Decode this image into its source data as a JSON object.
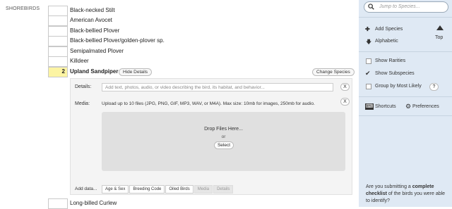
{
  "checklist": {
    "section_label": "SHOREBIRDS",
    "species": [
      {
        "name": "Black-necked Stilt",
        "count": ""
      },
      {
        "name": "American Avocet",
        "count": ""
      },
      {
        "name": "Black-bellied Plover",
        "count": ""
      },
      {
        "name": "Black-bellied Plover/golden-plover sp.",
        "count": ""
      },
      {
        "name": "Semipalmated Plover",
        "count": ""
      },
      {
        "name": "Killdeer",
        "count": ""
      },
      {
        "name": "Upland Sandpiper",
        "count": "2"
      },
      {
        "name": "Long-billed Curlew",
        "count": ""
      }
    ],
    "hide_details_label": "Hide Details",
    "change_species_label": "Change Species"
  },
  "details": {
    "details_label": "Details:",
    "details_placeholder": "Add text, photos, audio, or video describing the bird, its habitat, and behavior...",
    "close_label": "X",
    "media_label": "Media:",
    "media_text": "Upload up to 10 files (JPG, PNG, GIF, MP3, WAV, or M4A). Max size: 10mb for images, 250mb for audio.",
    "drop_title": "Drop Files Here...",
    "drop_or": "or",
    "select_label": "Select",
    "add_data_label": "Add data...",
    "tabs": [
      {
        "label": "Age & Sex",
        "enabled": true
      },
      {
        "label": "Breeding Code",
        "enabled": true
      },
      {
        "label": "Oiled Birds",
        "enabled": true
      },
      {
        "label": "Media",
        "enabled": false
      },
      {
        "label": "Details",
        "enabled": false
      }
    ]
  },
  "sidebar": {
    "search_placeholder": "Jump to Species...",
    "add_species_label": "Add Species",
    "alphabetic_label": "Alphabetic",
    "top_label": "Top",
    "show_rarities_label": "Show Rarities",
    "show_rarities_checked": false,
    "show_subspecies_label": "Show Subspecies",
    "show_subspecies_checked": true,
    "group_by_label": "Group by Most Likely",
    "group_by_checked": false,
    "help_label": "?",
    "shortcuts_label": "Shortcuts",
    "preferences_label": "Preferences",
    "prompt_prefix": "Are you submitting a ",
    "prompt_bold": "complete checklist",
    "prompt_suffix": " of the birds you were able to identify?"
  },
  "colors": {
    "active_count_bg": "#fcf4a3",
    "sidebar_bg": "#dfe9f4"
  }
}
